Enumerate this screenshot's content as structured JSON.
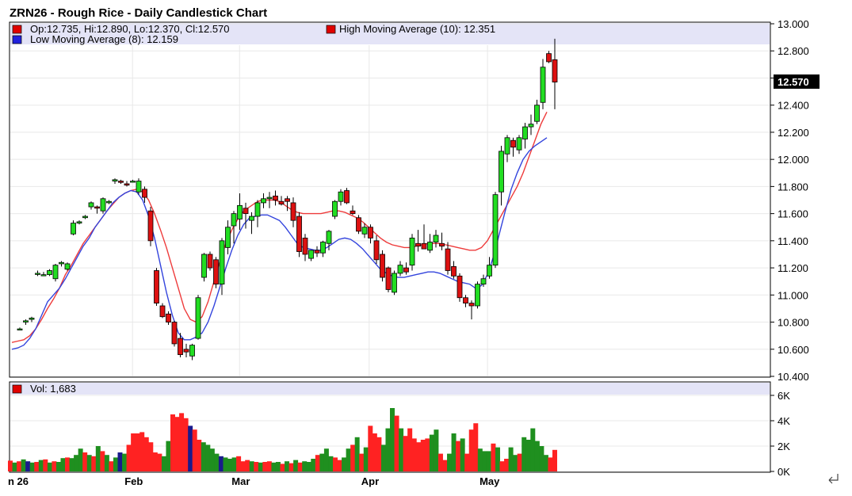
{
  "chart_data": {
    "type": "candlestick",
    "title": "ZRN26 - Rough Rice - Daily Candlestick Chart",
    "ohlc_text": "Op:12.735, Hi:12.890, Lo:12.370, Cl:12.570",
    "high_ma_label": "High Moving Average (10): 12.351",
    "low_ma_label": "Low Moving Average (8): 12.159",
    "last_price": "12.570",
    "y_ticks": [
      "13.000",
      "12.800",
      "12.600",
      "12.400",
      "12.200",
      "12.000",
      "11.800",
      "11.600",
      "11.400",
      "11.200",
      "11.000",
      "10.800",
      "10.600",
      "10.400"
    ],
    "ylim": [
      10.4,
      13.0
    ],
    "volume_label": "Vol: 1,683",
    "volume_ticks": [
      "6K",
      "4K",
      "2K",
      "0K"
    ],
    "volume_ylim": [
      0,
      6000
    ],
    "x_labels": [
      {
        "label": "n 26",
        "index": 0
      },
      {
        "label": "Feb",
        "index": 20
      },
      {
        "label": "Mar",
        "index": 39
      },
      {
        "label": "Apr",
        "index": 62
      },
      {
        "label": "May",
        "index": 83
      }
    ],
    "candles": [
      [
        10.75,
        10.76,
        10.74,
        10.75
      ],
      [
        10.8,
        10.82,
        10.78,
        10.81
      ],
      [
        10.82,
        10.84,
        10.8,
        10.83
      ],
      [
        11.16,
        11.18,
        11.14,
        11.16
      ],
      [
        11.15,
        11.17,
        11.14,
        11.15
      ],
      [
        11.15,
        11.19,
        11.14,
        11.18
      ],
      [
        11.12,
        11.23,
        11.1,
        11.22
      ],
      [
        11.23,
        11.25,
        11.21,
        11.24
      ],
      [
        11.19,
        11.24,
        11.18,
        11.23
      ],
      [
        11.45,
        11.55,
        11.44,
        11.53
      ],
      [
        11.53,
        11.55,
        11.52,
        11.54
      ],
      [
        11.57,
        11.59,
        11.56,
        11.58
      ],
      [
        11.65,
        11.69,
        11.63,
        11.68
      ],
      [
        11.65,
        11.66,
        11.6,
        11.64
      ],
      [
        11.62,
        11.72,
        11.6,
        11.71
      ],
      [
        11.68,
        11.7,
        11.67,
        11.69
      ],
      [
        11.84,
        11.86,
        11.82,
        11.85
      ],
      [
        11.84,
        11.85,
        11.82,
        11.83
      ],
      [
        11.82,
        11.84,
        11.8,
        11.81
      ],
      [
        11.84,
        11.85,
        11.83,
        11.84
      ],
      [
        11.76,
        11.86,
        11.74,
        11.84
      ],
      [
        11.78,
        11.8,
        11.68,
        11.72
      ],
      [
        11.62,
        11.65,
        11.36,
        11.4
      ],
      [
        11.18,
        11.2,
        10.92,
        10.94
      ],
      [
        10.92,
        10.94,
        10.83,
        10.84
      ],
      [
        10.86,
        10.88,
        10.78,
        10.8
      ],
      [
        10.8,
        10.81,
        10.62,
        10.64
      ],
      [
        10.68,
        10.72,
        10.54,
        10.56
      ],
      [
        10.6,
        10.64,
        10.54,
        10.58
      ],
      [
        10.55,
        10.64,
        10.52,
        10.63
      ],
      [
        10.68,
        11.0,
        10.67,
        10.98
      ],
      [
        11.13,
        11.31,
        11.1,
        11.3
      ],
      [
        11.3,
        11.32,
        11.18,
        11.2
      ],
      [
        11.26,
        11.28,
        11.05,
        11.08
      ],
      [
        11.08,
        11.42,
        11.0,
        11.4
      ],
      [
        11.35,
        11.55,
        11.3,
        11.5
      ],
      [
        11.51,
        11.62,
        11.38,
        11.6
      ],
      [
        11.56,
        11.75,
        11.48,
        11.66
      ],
      [
        11.64,
        11.68,
        11.49,
        11.6
      ],
      [
        11.55,
        11.61,
        11.45,
        11.58
      ],
      [
        11.58,
        11.7,
        11.5,
        11.68
      ],
      [
        11.68,
        11.75,
        11.64,
        11.71
      ],
      [
        11.71,
        11.76,
        11.64,
        11.72
      ],
      [
        11.73,
        11.77,
        11.66,
        11.7
      ],
      [
        11.69,
        11.73,
        11.66,
        11.67
      ],
      [
        11.71,
        11.73,
        11.62,
        11.69
      ],
      [
        11.68,
        11.72,
        11.5,
        11.55
      ],
      [
        11.58,
        11.61,
        11.28,
        11.32
      ],
      [
        11.42,
        11.45,
        11.25,
        11.3
      ],
      [
        11.27,
        11.32,
        11.25,
        11.33
      ],
      [
        11.33,
        11.36,
        11.28,
        11.31
      ],
      [
        11.31,
        11.4,
        11.28,
        11.39
      ],
      [
        11.38,
        11.48,
        11.33,
        11.47
      ],
      [
        11.58,
        11.7,
        11.56,
        11.69
      ],
      [
        11.69,
        11.78,
        11.66,
        11.76
      ],
      [
        11.77,
        11.79,
        11.67,
        11.68
      ],
      [
        11.62,
        11.66,
        11.59,
        11.6
      ],
      [
        11.57,
        11.59,
        11.45,
        11.47
      ],
      [
        11.45,
        11.53,
        11.42,
        11.5
      ],
      [
        11.5,
        11.52,
        11.38,
        11.42
      ],
      [
        11.4,
        11.44,
        11.23,
        11.26
      ],
      [
        11.3,
        11.33,
        11.1,
        11.13
      ],
      [
        11.2,
        11.21,
        11.02,
        11.04
      ],
      [
        11.02,
        11.18,
        11.0,
        11.16
      ],
      [
        11.16,
        11.25,
        11.14,
        11.22
      ],
      [
        11.2,
        11.24,
        11.15,
        11.17
      ],
      [
        11.22,
        11.45,
        11.18,
        11.42
      ],
      [
        11.38,
        11.48,
        11.32,
        11.36
      ],
      [
        11.38,
        11.52,
        11.34,
        11.34
      ],
      [
        11.33,
        11.45,
        11.31,
        11.39
      ],
      [
        11.39,
        11.48,
        11.35,
        11.44
      ],
      [
        11.38,
        11.46,
        11.33,
        11.36
      ],
      [
        11.34,
        11.39,
        11.15,
        11.18
      ],
      [
        11.21,
        11.25,
        11.12,
        11.14
      ],
      [
        11.14,
        11.16,
        10.95,
        10.98
      ],
      [
        10.98,
        11.0,
        10.91,
        10.94
      ],
      [
        10.94,
        10.96,
        10.82,
        10.92
      ],
      [
        10.92,
        11.1,
        10.9,
        11.08
      ],
      [
        11.08,
        11.15,
        11.06,
        11.12
      ],
      [
        11.14,
        11.28,
        11.12,
        11.22
      ],
      [
        11.22,
        11.76,
        11.2,
        11.74
      ],
      [
        11.76,
        12.1,
        11.66,
        12.06
      ],
      [
        12.04,
        12.18,
        11.98,
        12.16
      ],
      [
        12.14,
        12.16,
        12.02,
        12.09
      ],
      [
        12.07,
        12.18,
        12.04,
        12.16
      ],
      [
        12.15,
        12.27,
        12.08,
        12.24
      ],
      [
        12.24,
        12.33,
        12.18,
        12.26
      ],
      [
        12.28,
        12.44,
        12.26,
        12.4
      ],
      [
        12.42,
        12.74,
        12.37,
        12.68
      ],
      [
        12.78,
        12.8,
        12.71,
        12.72
      ],
      [
        12.735,
        12.89,
        12.37,
        12.57
      ]
    ],
    "high_ma": [
      10.65,
      10.66,
      10.67,
      10.7,
      10.75,
      10.82,
      10.9,
      10.97,
      11.05,
      11.15,
      11.22,
      11.3,
      11.38,
      11.44,
      11.5,
      11.56,
      11.62,
      11.67,
      11.72,
      11.75,
      11.77,
      11.78,
      11.76,
      11.7,
      11.6,
      11.48,
      11.35,
      11.2,
      11.05,
      10.9,
      10.82,
      10.8,
      10.84,
      10.95,
      11.1,
      11.25,
      11.38,
      11.48,
      11.56,
      11.62,
      11.65,
      11.68,
      11.7,
      11.7,
      11.7,
      11.69,
      11.66,
      11.63,
      11.61,
      11.6,
      11.6,
      11.6,
      11.6,
      11.61,
      11.62,
      11.62,
      11.61,
      11.59,
      11.57,
      11.54,
      11.5,
      11.46,
      11.42,
      11.39,
      11.37,
      11.36,
      11.35,
      11.35,
      11.36,
      11.37,
      11.38,
      11.38,
      11.38,
      11.37,
      11.36,
      11.35,
      11.34,
      11.33,
      11.33,
      11.35,
      11.4,
      11.48,
      11.56,
      11.64,
      11.72,
      11.8,
      11.9,
      12.02,
      12.14,
      12.26,
      12.35
    ],
    "low_ma": [
      10.6,
      10.61,
      10.63,
      10.68,
      10.75,
      10.85,
      10.95,
      11.0,
      11.05,
      11.12,
      11.2,
      11.28,
      11.36,
      11.42,
      11.5,
      11.56,
      11.62,
      11.68,
      11.72,
      11.75,
      11.77,
      11.76,
      11.7,
      11.58,
      11.42,
      11.22,
      11.02,
      10.85,
      10.72,
      10.67,
      10.67,
      10.69,
      10.72,
      10.8,
      10.92,
      11.06,
      11.2,
      11.33,
      11.44,
      11.52,
      11.57,
      11.58,
      11.59,
      11.59,
      11.57,
      11.55,
      11.5,
      11.44,
      11.38,
      11.35,
      11.34,
      11.33,
      11.33,
      11.35,
      11.38,
      11.41,
      11.42,
      11.41,
      11.38,
      11.34,
      11.29,
      11.24,
      11.19,
      11.16,
      11.14,
      11.13,
      11.13,
      11.14,
      11.15,
      11.16,
      11.17,
      11.17,
      11.16,
      11.14,
      11.12,
      11.1,
      11.09,
      11.08,
      11.05,
      11.07,
      11.15,
      11.28,
      11.45,
      11.62,
      11.78,
      11.9,
      12.0,
      12.06,
      12.1,
      12.13,
      12.16
    ],
    "volume": [
      850,
      700,
      800,
      950,
      800,
      700,
      750,
      900,
      950,
      700,
      800,
      750,
      1050,
      1100,
      1050,
      1300,
      1800,
      1500,
      1300,
      1200,
      2000,
      1600,
      1300,
      800,
      1100,
      1500,
      1400,
      2100,
      3000,
      3000,
      3100,
      2700,
      2300,
      1500,
      1400,
      1200,
      2400,
      4500,
      4300,
      4600,
      4200,
      3600,
      3300,
      2500,
      2300,
      2100,
      1800,
      1400,
      1200,
      1100,
      1000,
      1100,
      1200,
      800,
      900,
      800,
      750,
      700,
      750,
      800,
      700,
      750,
      600,
      800,
      650,
      900,
      700,
      800,
      750,
      1000,
      1300,
      1400,
      1800,
      1200,
      1100,
      900,
      1100,
      1800,
      2100,
      2700,
      1400,
      1900,
      3600,
      3000,
      2700,
      2100,
      3400,
      5000,
      4400,
      3400,
      2800,
      3400,
      2600,
      2300,
      2500,
      2600,
      2900,
      3300,
      1400,
      900,
      1400,
      3000,
      2400,
      2600,
      1400,
      3300,
      3800,
      1800,
      1600,
      1600,
      2200,
      1900,
      800,
      1000,
      1900,
      1300,
      1400,
      2700,
      2500,
      3400,
      2400,
      2000,
      1300,
      1100,
      1700
    ],
    "volume_up": [
      0,
      1,
      0,
      1,
      0,
      1,
      0,
      1,
      0,
      1,
      0,
      1,
      1,
      0,
      1,
      1,
      1,
      0,
      1,
      0,
      1,
      0,
      1,
      0,
      1,
      0,
      1,
      0,
      0,
      0,
      0,
      0,
      0,
      0,
      0,
      1,
      1,
      0,
      0,
      0,
      0,
      0,
      0,
      0,
      1,
      1,
      1,
      1,
      1,
      1,
      1,
      1,
      0,
      0,
      0,
      1,
      0,
      1,
      0,
      0,
      1,
      1,
      0,
      1,
      0,
      1,
      0,
      1,
      1,
      1,
      0,
      1,
      1,
      1,
      0,
      0,
      1,
      1,
      0,
      1,
      0,
      1,
      0,
      0,
      0,
      1,
      1,
      1,
      0,
      1,
      0,
      0,
      0,
      0,
      0,
      0,
      1,
      1,
      0,
      0,
      1,
      1,
      0,
      1,
      0,
      0,
      0,
      1,
      1,
      1,
      0,
      1,
      0,
      0,
      1,
      1,
      0,
      1,
      1,
      1,
      1,
      1,
      1,
      0,
      0,
      1
    ],
    "volume_blue": [
      4,
      25,
      41,
      48
    ]
  }
}
